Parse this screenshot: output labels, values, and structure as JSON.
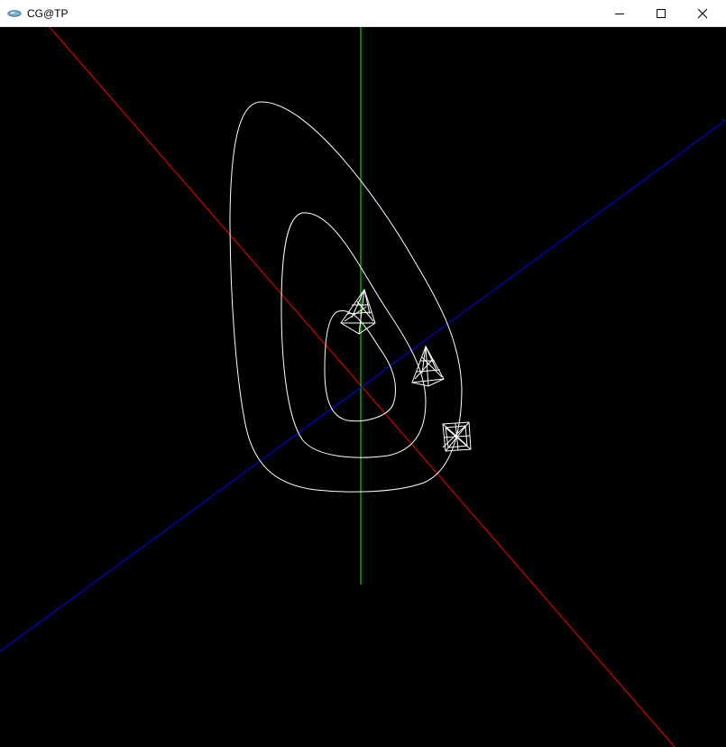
{
  "window": {
    "title": "CG@TP",
    "app_icon": "opengl-glut-icon",
    "controls": [
      "minimize-icon",
      "maximize-icon",
      "close-icon"
    ]
  },
  "scene": {
    "background_color": "#000000",
    "axis_colors": {
      "x": "#ff0000",
      "y": "#00ff00",
      "z": "#0000ff"
    },
    "curve_color": "#ffffff",
    "orbit_curve_count": 3,
    "wireframe_object_count": 3,
    "wireframe_objects": [
      "pyramid",
      "pyramid",
      "cube"
    ]
  }
}
